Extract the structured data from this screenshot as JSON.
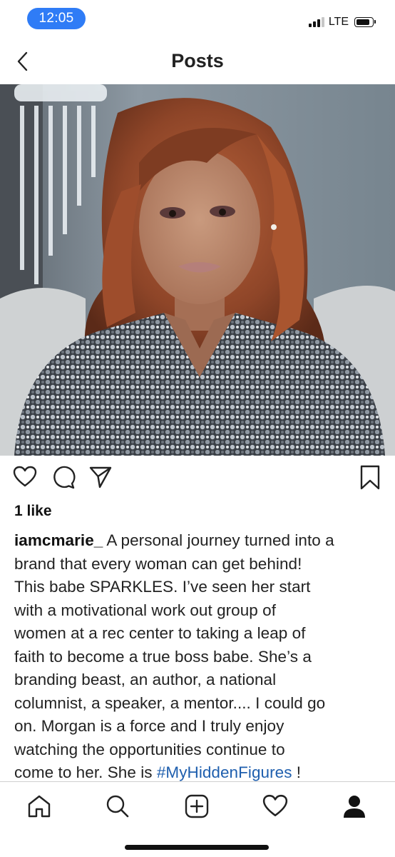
{
  "status_bar": {
    "time": "12:05",
    "network": "LTE",
    "signal_bars": 4,
    "signal_active_bars": 3,
    "battery_level": 0.85,
    "time_pill_color": "#2f7cf6"
  },
  "nav": {
    "title": "Posts",
    "back_icon": "chevron-left-icon"
  },
  "post": {
    "image_alt": "Portrait of a woman with auburn wavy hair wearing a sequined jacket",
    "actions": [
      "heart-icon",
      "comment-icon",
      "share-icon",
      "bookmark-icon"
    ],
    "likes": "1 like",
    "caption": {
      "username": "iamcmarie_",
      "lines": [
        " A personal journey turned into a",
        "brand that every woman can get behind!",
        "This babe SPARKLES. I’ve seen her start",
        "with a motivational work out group of",
        "women at a rec center to taking a leap of",
        "faith to become a true boss babe. She’s a",
        "branding beast, an author, a national",
        "columnist, a speaker, a mentor.... I could go",
        "on. Morgan is a force and I truly enjoy",
        "watching the opportunities continue to"
      ],
      "last_line_prefix": "come to her. She is ",
      "hashtag": "#MyHiddenFigures",
      "last_line_suffix": " !"
    },
    "hashtag_color": "#1f5fae"
  },
  "tabbar": {
    "items": [
      "home-icon",
      "search-icon",
      "add-post-icon",
      "activity-heart-icon",
      "profile-icon"
    ]
  }
}
